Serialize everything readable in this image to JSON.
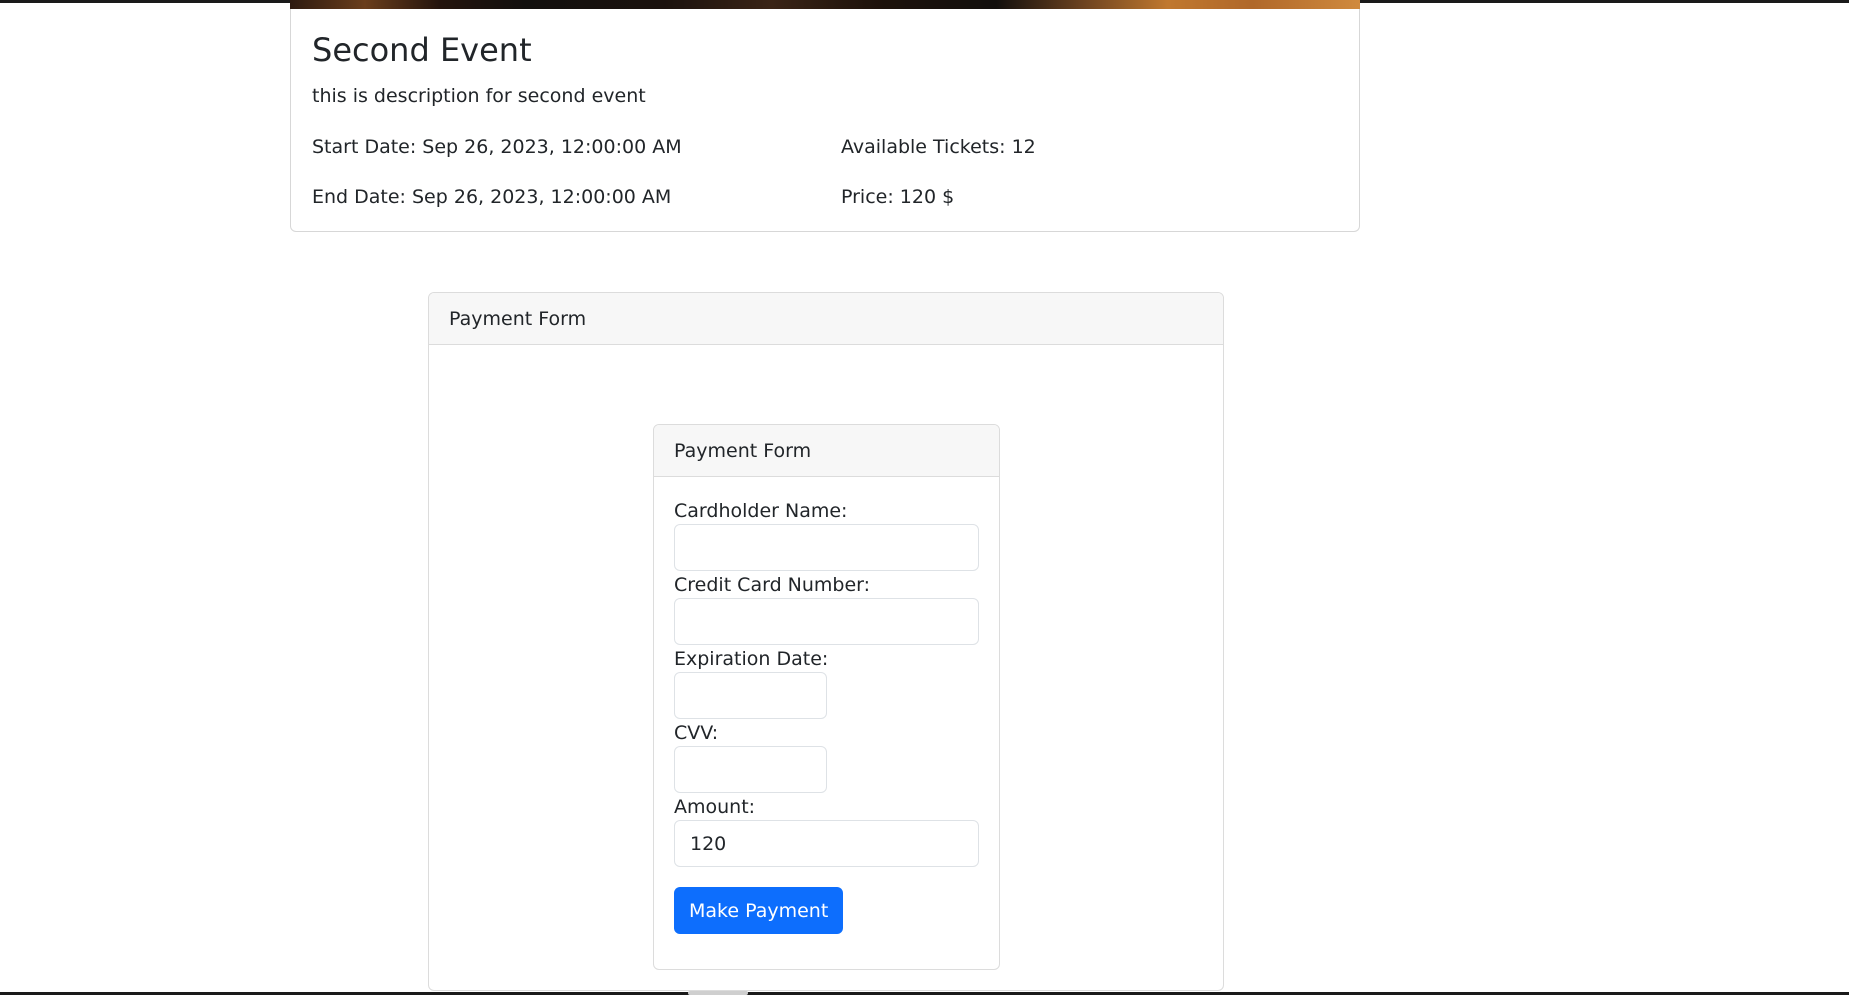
{
  "event": {
    "title": "Second Event",
    "description": "this is description for second event",
    "start_date": "Start Date: Sep 26, 2023, 12:00:00 AM",
    "end_date": "End Date: Sep 26, 2023, 12:00:00 AM",
    "available_tickets": "Available Tickets: 12",
    "price": "Price: 120 $"
  },
  "outer_card": {
    "header": "Payment Form"
  },
  "payment_form": {
    "header": "Payment Form",
    "cardholder_label": "Cardholder Name:",
    "cardholder_value": "",
    "card_number_label": "Credit Card Number:",
    "card_number_value": "",
    "expiration_label": "Expiration Date:",
    "expiration_value": "",
    "cvv_label": "CVV:",
    "cvv_value": "",
    "amount_label": "Amount:",
    "amount_value": "120",
    "submit_label": "Make Payment"
  },
  "colors": {
    "primary_button": "#0d6efd",
    "card_header_bg": "#f7f7f7",
    "border": "#dcdcdc"
  }
}
